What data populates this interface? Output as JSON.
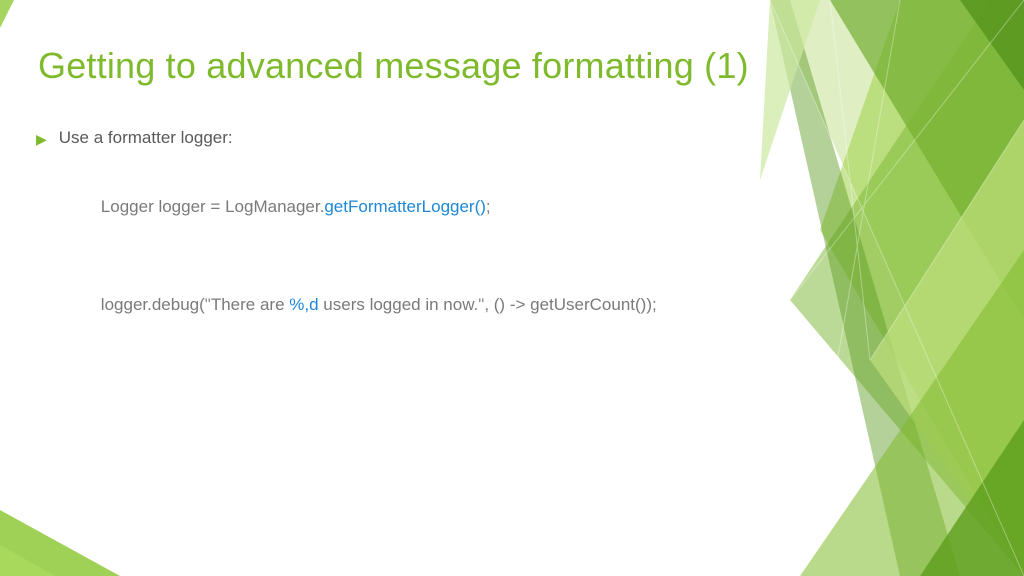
{
  "title": "Getting to advanced message formatting (1)",
  "bullet": "Use a formatter logger:",
  "code": {
    "line1_pre": "Logger logger = LogManager.",
    "line1_hl": "getFormatterLogger()",
    "line1_post": ";",
    "line2_pre": "logger.debug(",
    "line2_q1": "\"",
    "line2_mid1": "There are ",
    "line2_hl": "%,d",
    "line2_mid2": " users logged in now.",
    "line2_q2": "\"",
    "line2_post": ", () -> getUserCount());"
  },
  "colors": {
    "accent": "#7fba2c",
    "link": "#1e88d6"
  }
}
